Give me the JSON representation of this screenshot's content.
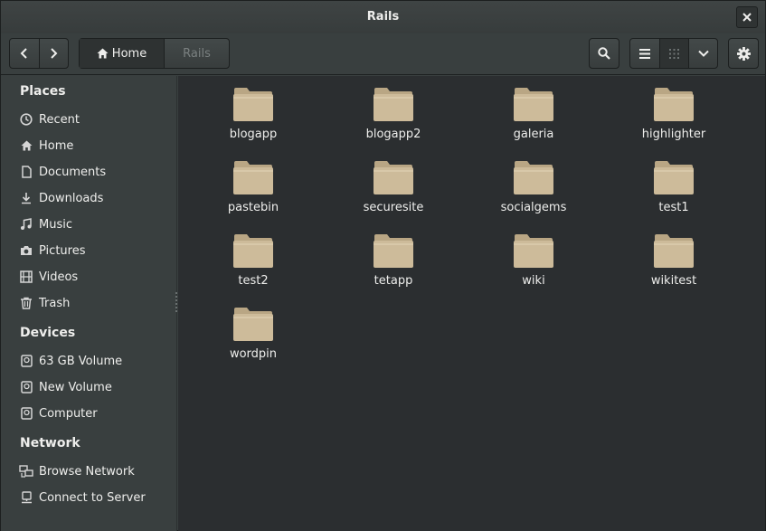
{
  "window": {
    "title": "Rails"
  },
  "toolbar": {
    "breadcrumbs": [
      "Home",
      "Rails"
    ]
  },
  "sidebar": {
    "places_header": "Places",
    "places": [
      {
        "label": "Recent",
        "icon": "clock-icon"
      },
      {
        "label": "Home",
        "icon": "home-icon"
      },
      {
        "label": "Documents",
        "icon": "document-icon"
      },
      {
        "label": "Downloads",
        "icon": "download-icon"
      },
      {
        "label": "Music",
        "icon": "music-icon"
      },
      {
        "label": "Pictures",
        "icon": "camera-icon"
      },
      {
        "label": "Videos",
        "icon": "film-icon"
      },
      {
        "label": "Trash",
        "icon": "trash-icon"
      }
    ],
    "devices_header": "Devices",
    "devices": [
      {
        "label": "63 GB Volume",
        "icon": "drive-icon"
      },
      {
        "label": "New Volume",
        "icon": "drive-icon"
      },
      {
        "label": "Computer",
        "icon": "drive-icon"
      }
    ],
    "network_header": "Network",
    "network": [
      {
        "label": "Browse Network",
        "icon": "network-icon"
      },
      {
        "label": "Connect to Server",
        "icon": "server-icon"
      }
    ]
  },
  "folders": [
    "blogapp",
    "blogapp2",
    "galeria",
    "highlighter",
    "pastebin",
    "securesite",
    "socialgems",
    "test1",
    "test2",
    "tetapp",
    "wiki",
    "wikitest",
    "wordpin"
  ],
  "colors": {
    "folder_body": "#cdbb9a",
    "folder_tab": "#b9a684",
    "sidebar_bg": "#393f3f",
    "content_bg": "#2b2e30"
  }
}
